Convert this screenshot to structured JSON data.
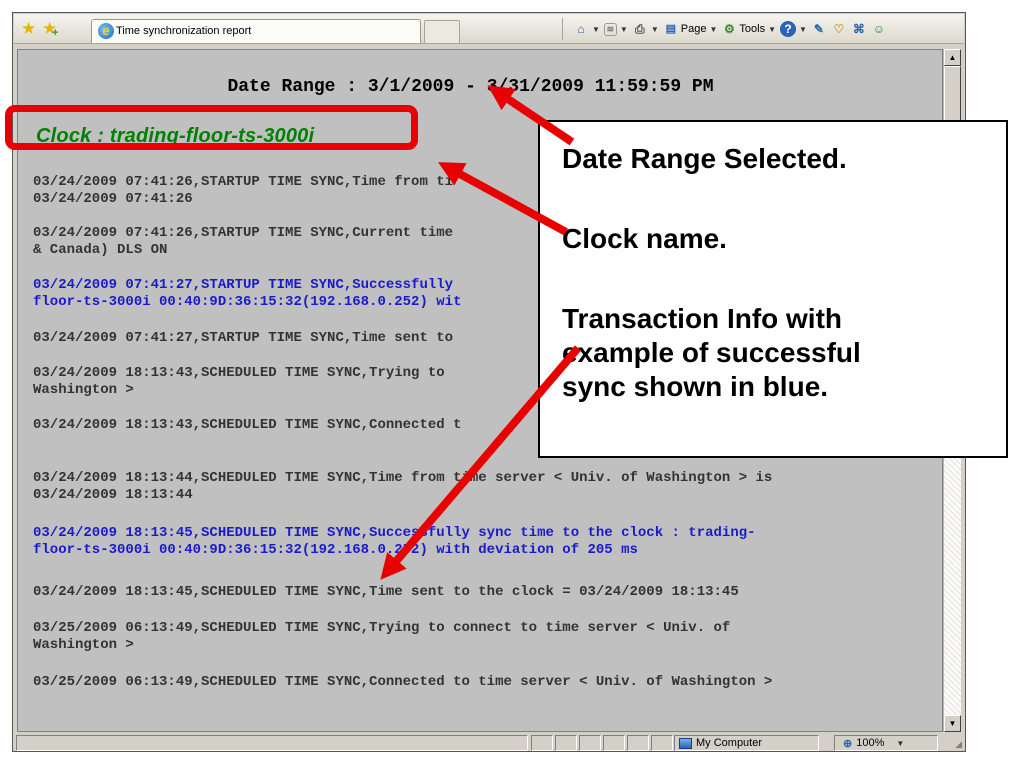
{
  "browser": {
    "tab_title": "Time synchronization report",
    "commands": {
      "page_label": "Page",
      "tools_label": "Tools"
    },
    "statusbar": {
      "zone": "My Computer",
      "zoom": "100%"
    }
  },
  "report": {
    "date_range": "Date Range : 3/1/2009 - 3/31/2009 11:59:59 PM",
    "clock_title": "Clock : trading-floor-ts-3000i",
    "entries": [
      {
        "text": "03/24/2009 07:41:26,STARTUP TIME SYNC,Time from ti\n03/24/2009 07:41:26"
      },
      {
        "text": "03/24/2009 07:41:26,STARTUP TIME SYNC,Current time\n& Canada) DLS ON"
      },
      {
        "text": "03/24/2009 07:41:27,STARTUP TIME SYNC,Successfully\nfloor-ts-3000i 00:40:9D:36:15:32(192.168.0.252) wit"
      },
      {
        "text": "03/24/2009 07:41:27,STARTUP TIME SYNC,Time sent to"
      },
      {
        "text": "03/24/2009 18:13:43,SCHEDULED TIME SYNC,Trying to\nWashington >"
      },
      {
        "text": "03/24/2009 18:13:43,SCHEDULED TIME SYNC,Connected t"
      },
      {
        "text": "03/24/2009 18:13:44,SCHEDULED TIME SYNC,Time from time server < Univ. of Washington > is\n03/24/2009 18:13:44"
      },
      {
        "text": "03/24/2009 18:13:45,SCHEDULED TIME SYNC,Successfully sync time to the clock : trading-\nfloor-ts-3000i 00:40:9D:36:15:32(192.168.0.252) with deviation of 205 ms"
      },
      {
        "text": "03/24/2009 18:13:45,SCHEDULED TIME SYNC,Time sent to the clock = 03/24/2009 18:13:45"
      },
      {
        "text": "03/25/2009 06:13:49,SCHEDULED TIME SYNC,Trying to connect to time server < Univ. of\nWashington >"
      },
      {
        "text": "03/25/2009 06:13:49,SCHEDULED TIME SYNC,Connected to time server < Univ. of Washington >"
      }
    ]
  },
  "callout": {
    "date_range_note": "Date Range Selected.",
    "clock_name_note": "Clock name.",
    "transaction_line1": "Transaction Info with",
    "transaction_line2": "example of successful",
    "transaction_line3": "sync shown in blue."
  },
  "colors": {
    "success_text": "#1a1acd",
    "clock_title": "#008000",
    "highlight": "#e80000",
    "page_background": "#c0c0c0"
  }
}
